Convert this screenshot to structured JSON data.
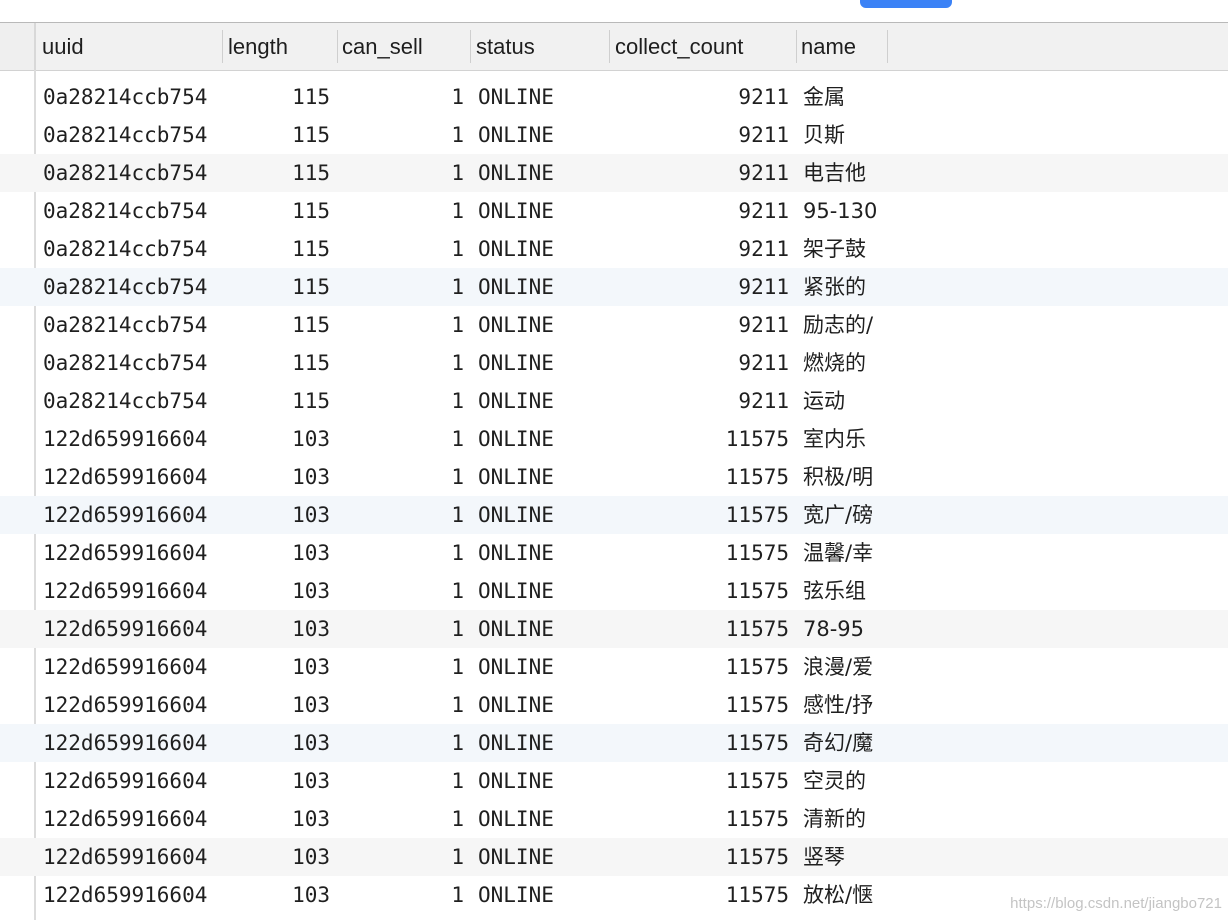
{
  "columns": {
    "uuid": "uuid",
    "length": "length",
    "can_sell": "can_sell",
    "status": "status",
    "collect_count": "collect_count",
    "name": "name"
  },
  "rows": [
    {
      "uuid": "0a28214ccb754",
      "length": "115",
      "can_sell": "1",
      "status": "ONLINE",
      "collect_count": "9211",
      "name": "金属"
    },
    {
      "uuid": "0a28214ccb754",
      "length": "115",
      "can_sell": "1",
      "status": "ONLINE",
      "collect_count": "9211",
      "name": "贝斯"
    },
    {
      "uuid": "0a28214ccb754",
      "length": "115",
      "can_sell": "1",
      "status": "ONLINE",
      "collect_count": "9211",
      "name": "电吉他"
    },
    {
      "uuid": "0a28214ccb754",
      "length": "115",
      "can_sell": "1",
      "status": "ONLINE",
      "collect_count": "9211",
      "name": "95-130"
    },
    {
      "uuid": "0a28214ccb754",
      "length": "115",
      "can_sell": "1",
      "status": "ONLINE",
      "collect_count": "9211",
      "name": "架子鼓"
    },
    {
      "uuid": "0a28214ccb754",
      "length": "115",
      "can_sell": "1",
      "status": "ONLINE",
      "collect_count": "9211",
      "name": "紧张的"
    },
    {
      "uuid": "0a28214ccb754",
      "length": "115",
      "can_sell": "1",
      "status": "ONLINE",
      "collect_count": "9211",
      "name": "励志的/"
    },
    {
      "uuid": "0a28214ccb754",
      "length": "115",
      "can_sell": "1",
      "status": "ONLINE",
      "collect_count": "9211",
      "name": "燃烧的"
    },
    {
      "uuid": "0a28214ccb754",
      "length": "115",
      "can_sell": "1",
      "status": "ONLINE",
      "collect_count": "9211",
      "name": "运动"
    },
    {
      "uuid": "122d659916604",
      "length": "103",
      "can_sell": "1",
      "status": "ONLINE",
      "collect_count": "11575",
      "name": "室内乐"
    },
    {
      "uuid": "122d659916604",
      "length": "103",
      "can_sell": "1",
      "status": "ONLINE",
      "collect_count": "11575",
      "name": "积极/明"
    },
    {
      "uuid": "122d659916604",
      "length": "103",
      "can_sell": "1",
      "status": "ONLINE",
      "collect_count": "11575",
      "name": "宽广/磅"
    },
    {
      "uuid": "122d659916604",
      "length": "103",
      "can_sell": "1",
      "status": "ONLINE",
      "collect_count": "11575",
      "name": "温馨/幸"
    },
    {
      "uuid": "122d659916604",
      "length": "103",
      "can_sell": "1",
      "status": "ONLINE",
      "collect_count": "11575",
      "name": "弦乐组"
    },
    {
      "uuid": "122d659916604",
      "length": "103",
      "can_sell": "1",
      "status": "ONLINE",
      "collect_count": "11575",
      "name": "78-95"
    },
    {
      "uuid": "122d659916604",
      "length": "103",
      "can_sell": "1",
      "status": "ONLINE",
      "collect_count": "11575",
      "name": "浪漫/爱"
    },
    {
      "uuid": "122d659916604",
      "length": "103",
      "can_sell": "1",
      "status": "ONLINE",
      "collect_count": "11575",
      "name": "感性/抒"
    },
    {
      "uuid": "122d659916604",
      "length": "103",
      "can_sell": "1",
      "status": "ONLINE",
      "collect_count": "11575",
      "name": "奇幻/魔"
    },
    {
      "uuid": "122d659916604",
      "length": "103",
      "can_sell": "1",
      "status": "ONLINE",
      "collect_count": "11575",
      "name": "空灵的"
    },
    {
      "uuid": "122d659916604",
      "length": "103",
      "can_sell": "1",
      "status": "ONLINE",
      "collect_count": "11575",
      "name": "清新的"
    },
    {
      "uuid": "122d659916604",
      "length": "103",
      "can_sell": "1",
      "status": "ONLINE",
      "collect_count": "11575",
      "name": "竖琴"
    },
    {
      "uuid": "122d659916604",
      "length": "103",
      "can_sell": "1",
      "status": "ONLINE",
      "collect_count": "11575",
      "name": "放松/惬"
    }
  ],
  "watermark": "https://blog.csdn.net/jiangbo721",
  "colors": {
    "accent": "#3b82f6",
    "header_bg": "#f1f1f1",
    "alt_row_bg": "#f6f6f6",
    "selected_row_bg": "#f3f7fb"
  }
}
